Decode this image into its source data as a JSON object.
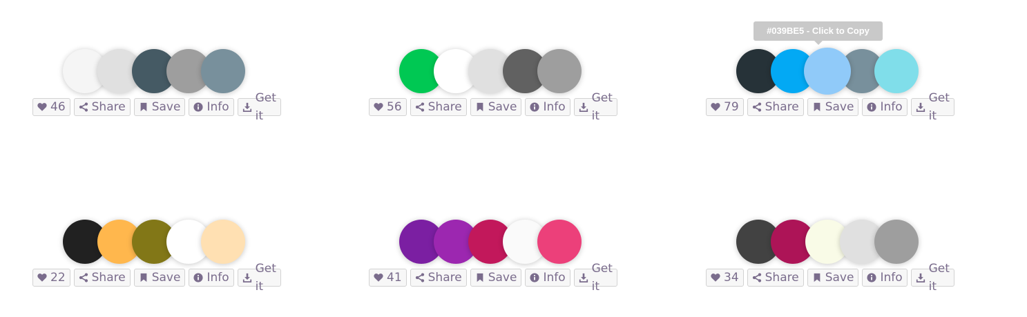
{
  "tooltip": {
    "text": "#039BE5 - Click to Copy"
  },
  "labels": {
    "share": "Share",
    "save": "Save",
    "info": "Info",
    "get": "Get it"
  },
  "palettes": [
    {
      "likes": "46",
      "colors": [
        "#f5f5f5",
        "#e0e0e0",
        "#455a64",
        "#9e9e9e",
        "#78909c"
      ]
    },
    {
      "likes": "56",
      "colors": [
        "#00c853",
        "#ffffff",
        "#e0e0e0",
        "#616161",
        "#9e9e9e"
      ]
    },
    {
      "likes": "79",
      "colors": [
        "#263238",
        "#03a9f4",
        "#90caf9",
        "#78909c",
        "#80deea"
      ]
    },
    {
      "likes": "22",
      "colors": [
        "#212121",
        "#ffb74d",
        "#827717",
        "#ffffff",
        "#ffe0b2"
      ]
    },
    {
      "likes": "41",
      "colors": [
        "#7b1fa2",
        "#9c27b0",
        "#c2185b",
        "#fafafa",
        "#ec407a"
      ]
    },
    {
      "likes": "34",
      "colors": [
        "#424242",
        "#ad1457",
        "#f9fbe7",
        "#e0e0e0",
        "#9e9e9e"
      ]
    }
  ]
}
